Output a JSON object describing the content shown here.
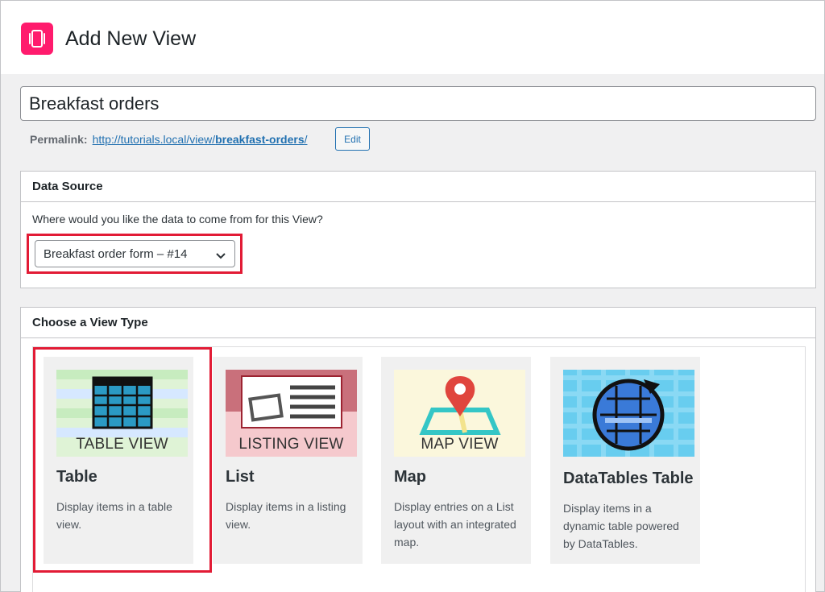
{
  "header": {
    "title": "Add New View",
    "logo_icon": "gravityview-logo-icon",
    "logo_color": "#ff1b6d"
  },
  "title_field": {
    "value": "Breakfast orders"
  },
  "permalink": {
    "label": "Permalink:",
    "url_base": "http://tutorials.local/view/",
    "url_slug": "breakfast-orders",
    "url_end": "/",
    "edit_label": "Edit"
  },
  "data_source": {
    "heading": "Data Source",
    "question": "Where would you like the data to come from for this View?",
    "selected": "Breakfast order form – #14"
  },
  "view_type": {
    "heading": "Choose a View Type",
    "cards": [
      {
        "name": "Table",
        "thumb_caption": "TABLE VIEW",
        "description": "Display items in a table view."
      },
      {
        "name": "List",
        "thumb_caption": "LISTING VIEW",
        "description": "Display items in a listing view."
      },
      {
        "name": "Map",
        "thumb_caption": "MAP VIEW",
        "description": "Display entries on a List layout with an integrated map."
      },
      {
        "name": "DataTables Table",
        "thumb_caption": "",
        "description": "Display items in a dynamic table powered by DataTables."
      }
    ]
  },
  "colors": {
    "highlight": "#e21b35",
    "link": "#2271b1"
  }
}
